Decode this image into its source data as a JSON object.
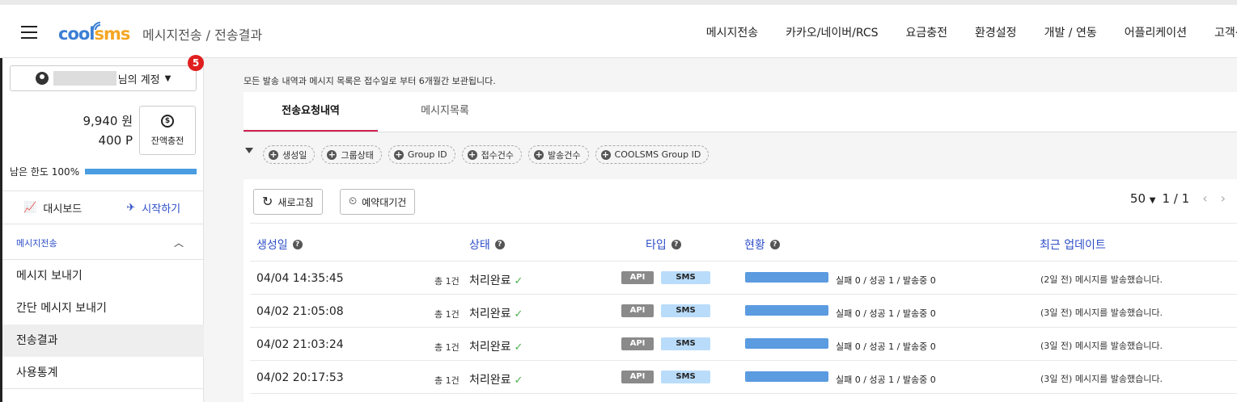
{
  "header": {
    "logo_a": "cool",
    "logo_b": "sms",
    "breadcrumb": "메시지전송  /  전송결과",
    "nav": [
      "메시지전송",
      "카카오/네이버/RCS",
      "요금충전",
      "환경설정",
      "개발 / 연동",
      "어플리케이션",
      "고객센터"
    ]
  },
  "sidebar": {
    "account_label": "님의 계정",
    "badge": "5",
    "balance_won": "9,940 원",
    "balance_point": "400 P",
    "recharge_label": "잔액충전",
    "limit_label": "남은 한도 100%",
    "limit_percent": 100,
    "dashboard": "대시보드",
    "start": "시작하기",
    "section": "메시지전송",
    "items": [
      "메시지 보내기",
      "간단 메시지 보내기",
      "전송결과",
      "사용통계"
    ]
  },
  "main": {
    "notice": "모든 발송 내역과 메시지 목록은 접수일로 부터 6개월간 보관됩니다.",
    "tabs": [
      "전송요청내역",
      "메시지목록"
    ],
    "filters": [
      "생성일",
      "그룹상태",
      "Group ID",
      "접수건수",
      "발송건수",
      "COOLSMS Group ID"
    ],
    "refresh": "새로고침",
    "scheduled": "예약대기건",
    "page_size": "50",
    "page": "1 / 1",
    "columns": [
      "생성일",
      "상태",
      "타입",
      "현황",
      "최근 업데이트"
    ],
    "rows": [
      {
        "date": "04/04 14:35:45",
        "count": "총 1건",
        "status": "처리완료",
        "api": "API",
        "type": "SMS",
        "progress": 100,
        "stat": "실패 0 / 성공 1 / 발송중 0",
        "update": "(2일 전) 메시지를 발송했습니다."
      },
      {
        "date": "04/02 21:05:08",
        "count": "총 1건",
        "status": "처리완료",
        "api": "API",
        "type": "SMS",
        "progress": 100,
        "stat": "실패 0 / 성공 1 / 발송중 0",
        "update": "(3일 전) 메시지를 발송했습니다."
      },
      {
        "date": "04/02 21:03:24",
        "count": "총 1건",
        "status": "처리완료",
        "api": "API",
        "type": "SMS",
        "progress": 100,
        "stat": "실패 0 / 성공 1 / 발송중 0",
        "update": "(3일 전) 메시지를 발송했습니다."
      },
      {
        "date": "04/02 20:17:53",
        "count": "총 1건",
        "status": "처리완료",
        "api": "API",
        "type": "SMS",
        "progress": 100,
        "stat": "실패 0 / 성공 1 / 발송중 0",
        "update": "(3일 전) 메시지를 발송했습니다."
      }
    ]
  }
}
